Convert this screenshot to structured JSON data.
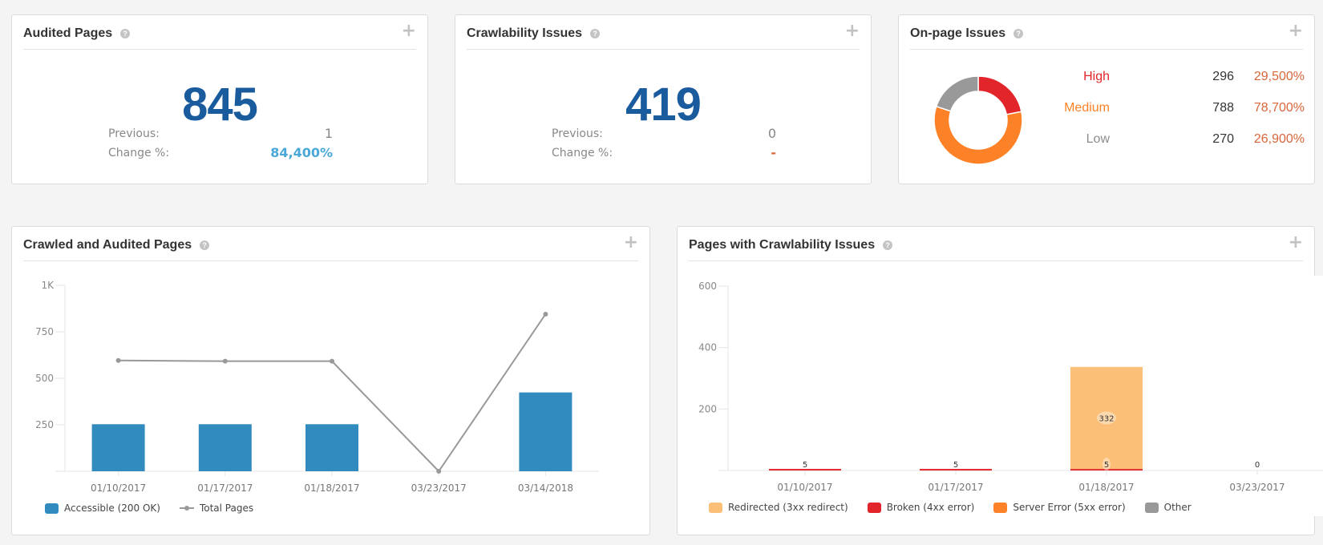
{
  "cards": {
    "audited": {
      "title": "Audited Pages",
      "value": "845",
      "previous_label": "Previous:",
      "previous_value": "1",
      "change_label": "Change %:",
      "change_value": "84,400%",
      "change_color": "#4aa8d8"
    },
    "crawlability": {
      "title": "Crawlability Issues",
      "value": "419",
      "previous_label": "Previous:",
      "previous_value": "0",
      "change_label": "Change %:",
      "change_value": "-",
      "change_color": "#d8663a"
    },
    "onpage": {
      "title": "On-page Issues",
      "rows": [
        {
          "label": "High",
          "count": "296",
          "pct": "29,500%",
          "color": "#e2252b"
        },
        {
          "label": "Medium",
          "count": "788",
          "pct": "78,700%",
          "color": "#fd8227"
        },
        {
          "label": "Low",
          "count": "270",
          "pct": "26,900%",
          "color": "#8c8c8c"
        }
      ]
    }
  },
  "crawled_chart": {
    "title": "Crawled and Audited Pages"
  },
  "crawl_issues_chart": {
    "title": "Pages with Crawlability Issues"
  },
  "chart_data": [
    {
      "type": "pie",
      "title": "On-page Issues",
      "donut": true,
      "categories": [
        "High",
        "Medium",
        "Low"
      ],
      "values": [
        296,
        788,
        270
      ],
      "colors": [
        "#e2252b",
        "#fd8227",
        "#999999"
      ]
    },
    {
      "type": "bar",
      "title": "Crawled and Audited Pages",
      "categories": [
        "01/10/2017",
        "01/17/2017",
        "01/18/2017",
        "03/23/2017",
        "03/14/2018"
      ],
      "series": [
        {
          "name": "Accessible (200 OK)",
          "type": "bar",
          "color": "#318bbe",
          "values": [
            253,
            253,
            253,
            0,
            424
          ]
        },
        {
          "name": "Total Pages",
          "type": "line",
          "color": "#999999",
          "values": [
            596,
            592,
            592,
            0,
            845
          ]
        }
      ],
      "yticks": [
        {
          "v": 250,
          "label": "250"
        },
        {
          "v": 500,
          "label": "500"
        },
        {
          "v": 750,
          "label": "750"
        },
        {
          "v": 1000,
          "label": "1K"
        }
      ],
      "ylim": [
        0,
        1000
      ],
      "legend": "bottom-left"
    },
    {
      "type": "bar",
      "stacked": true,
      "title": "Pages with Crawlability Issues",
      "categories": [
        "01/10/2017",
        "01/17/2017",
        "01/18/2017",
        "03/23/2017"
      ],
      "series": [
        {
          "name": "Redirected (3xx redirect)",
          "color": "#fbbf77",
          "values": [
            0,
            0,
            332,
            0
          ]
        },
        {
          "name": "Broken (4xx error)",
          "color": "#e2252b",
          "values": [
            5,
            5,
            5,
            0
          ]
        },
        {
          "name": "Server Error (5xx error)",
          "color": "#fd8227",
          "values": [
            0,
            0,
            0,
            0
          ]
        },
        {
          "name": "Other",
          "color": "#999999",
          "values": [
            0,
            0,
            0,
            0
          ]
        }
      ],
      "data_labels": [
        {
          "category": "01/10/2017",
          "series": "Broken (4xx error)",
          "label": "5"
        },
        {
          "category": "01/17/2017",
          "series": "Broken (4xx error)",
          "label": "5"
        },
        {
          "category": "01/18/2017",
          "series": "Redirected (3xx redirect)",
          "label": "332"
        },
        {
          "category": "01/18/2017",
          "series": "Broken (4xx error)",
          "label": "5"
        },
        {
          "category": "03/23/2017",
          "series": "total",
          "label": "0"
        }
      ],
      "yticks": [
        {
          "v": 200,
          "label": "200"
        },
        {
          "v": 400,
          "label": "400"
        },
        {
          "v": 600,
          "label": "600"
        }
      ],
      "ylim": [
        0,
        600
      ],
      "legend": "bottom-left"
    }
  ]
}
